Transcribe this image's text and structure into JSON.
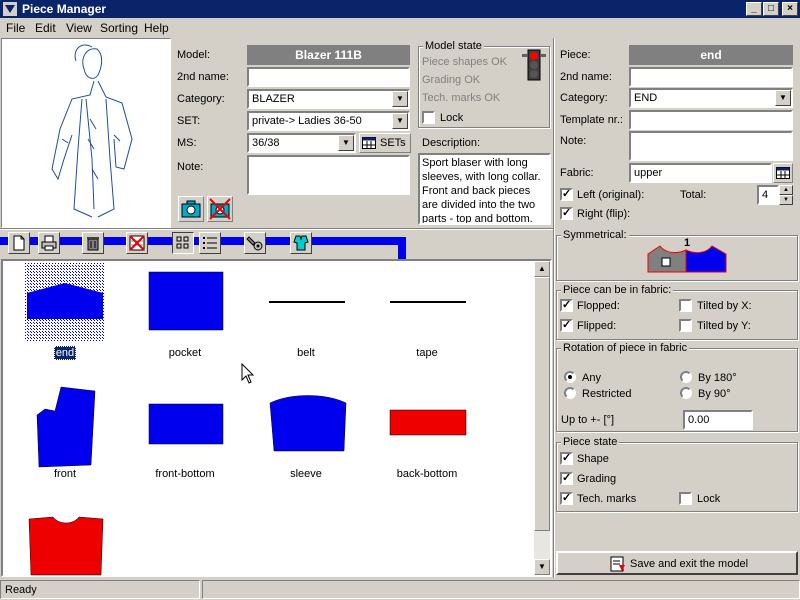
{
  "window": {
    "title": "Piece Manager",
    "controls": {
      "minimize": "_",
      "maximize": "□",
      "close": "×"
    }
  },
  "menu": [
    "File",
    "Edit",
    "View",
    "Sorting",
    "Help"
  ],
  "model": {
    "model_label": "Model:",
    "model_value": "Blazer 111B",
    "second_name_label": "2nd name:",
    "second_name_value": "",
    "category_label": "Category:",
    "category_value": "BLAZER",
    "set_label": "SET:",
    "set_value": "private-> Ladies 36-50",
    "ms_label": "MS:",
    "ms_value": "36/38",
    "sets_button": "SETs",
    "note_label": "Note:",
    "note_value": ""
  },
  "model_state": {
    "title": "Model state",
    "items": [
      "Piece shapes OK",
      "Grading OK",
      "Tech. marks OK"
    ],
    "lock_label": "Lock",
    "lock_checked": false
  },
  "description": {
    "label": "Description:",
    "text": "Sport blaser with long sleeves, with long collar. Front and back pieces are divided into the two parts - top and bottom. Arround"
  },
  "piece": {
    "piece_label": "Piece:",
    "piece_value": "end",
    "second_name_label": "2nd name:",
    "second_name_value": "",
    "category_label": "Category:",
    "category_value": "END",
    "template_label": "Template nr.:",
    "template_value": "",
    "note_label": "Note:",
    "note_value": "",
    "fabric_label": "Fabric:",
    "fabric_value": "upper",
    "left_label": "Left (original):",
    "left_checked": true,
    "right_label": "Right (flip):",
    "right_checked": true,
    "total_label": "Total:",
    "total_value": "4"
  },
  "symmetrical": {
    "title": "Symmetrical:",
    "number": "1"
  },
  "fabric_options": {
    "title": "Piece can be in fabric:",
    "flopped_label": "Flopped:",
    "flopped": true,
    "flipped_label": "Flipped:",
    "flipped": true,
    "tilted_x_label": "Tilted by X:",
    "tilted_x": false,
    "tilted_y_label": "Tilted by Y:",
    "tilted_y": false
  },
  "rotation": {
    "title": "Rotation of piece in fabric",
    "any_label": "Any",
    "restricted_label": "Restricted",
    "by180_label": "By 180°",
    "by90_label": "By 90°",
    "selected": "Any",
    "upto_label": "Up to +- [°]",
    "upto_value": "0.00"
  },
  "piece_state": {
    "title": "Piece state",
    "shape_label": "Shape",
    "shape": true,
    "grading_label": "Grading",
    "grading": true,
    "tech_label": "Tech. marks",
    "tech": true,
    "lock_label": "Lock",
    "lock": false
  },
  "save_button": "Save and exit the model",
  "pieces": [
    {
      "name": "end",
      "color": "#0000ee",
      "selected": true
    },
    {
      "name": "pocket",
      "color": "#0000ee"
    },
    {
      "name": "belt",
      "color": "#000000"
    },
    {
      "name": "tape",
      "color": "#000000"
    },
    {
      "name": "front",
      "color": "#0000ee"
    },
    {
      "name": "front-bottom",
      "color": "#0000ee"
    },
    {
      "name": "sleeve",
      "color": "#0000ee"
    },
    {
      "name": "back-bottom",
      "color": "#ee0000"
    },
    {
      "name": "",
      "color": "#ee0000"
    }
  ],
  "status": {
    "text": "Ready"
  }
}
